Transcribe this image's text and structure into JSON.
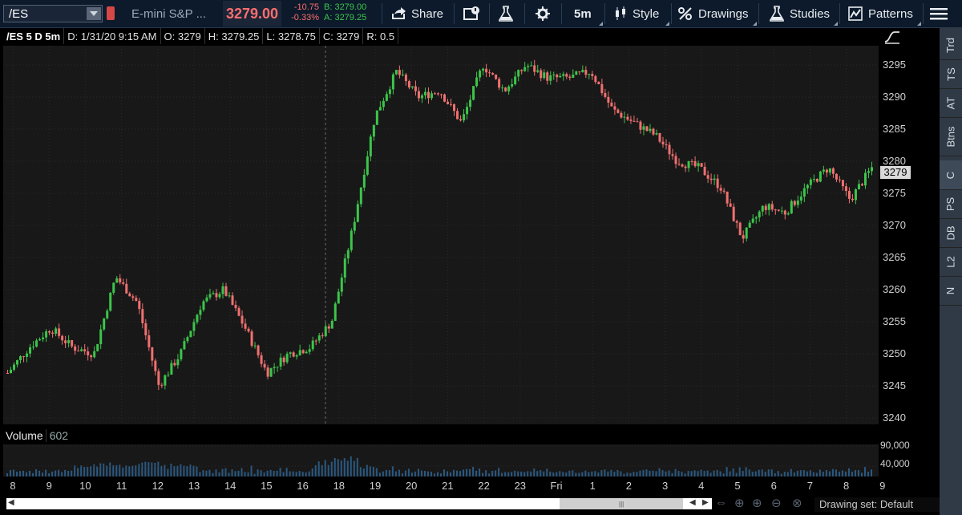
{
  "toolbar": {
    "symbol": "/ES",
    "description": "E-mini S&P ...",
    "last_price": "3279.00",
    "net_change": "-10.75",
    "pct_change": "-0.33%",
    "bid": "B: 3279.00",
    "ask": "A: 3279.25",
    "share": "Share",
    "aggregation": "5m",
    "style": "Style",
    "drawings": "Drawings",
    "studies": "Studies",
    "patterns": "Patterns"
  },
  "info_bar": {
    "symbol_period": "/ES 5 D 5m",
    "date": "D: 1/31/20 9:15 AM",
    "open": "O: 3279",
    "high": "H: 3279.25",
    "low": "L: 3278.75",
    "close": "C: 3279",
    "range": "R: 0.5"
  },
  "price_axis": {
    "labels": [
      "3295",
      "3290",
      "3285",
      "3280",
      "3275",
      "3270",
      "3265",
      "3260",
      "3255",
      "3250",
      "3245",
      "3240"
    ],
    "current_tag": "3279"
  },
  "volume": {
    "label": "Volume",
    "value": "602",
    "axis_labels": [
      "90,000",
      "40,000"
    ]
  },
  "time_axis": {
    "labels": [
      "8",
      "9",
      "10",
      "11",
      "12",
      "13",
      "14",
      "15",
      "16",
      "18",
      "19",
      "20",
      "21",
      "22",
      "23",
      "Fri",
      "1",
      "2",
      "3",
      "4",
      "5",
      "6",
      "7",
      "8",
      "9"
    ]
  },
  "right_panel": {
    "tabs": [
      "Trd",
      "TS",
      "AT",
      "Btns",
      "C",
      "PS",
      "DB",
      "L2",
      "N"
    ],
    "active": "C"
  },
  "bottom": {
    "drawing_set": "Drawing set: Default"
  },
  "colors": {
    "up": "#3cc54b",
    "down": "#f07070",
    "volume": "#3a8ed8",
    "background": "#181818",
    "toolbar": "#0c1a2b"
  },
  "chart_data": {
    "type": "candlestick",
    "interval": "5m",
    "ylim": [
      3239,
      3298
    ],
    "grid": true,
    "x": [
      "8",
      "9",
      "10",
      "11",
      "12",
      "13",
      "14",
      "15",
      "16",
      "18",
      "19",
      "20",
      "21",
      "22",
      "23",
      "Fri",
      "1",
      "2",
      "3",
      "4",
      "5",
      "6",
      "7",
      "8",
      "9"
    ],
    "series": [
      {
        "values": [
          3247,
          3251,
          3254,
          3251,
          3250,
          3262,
          3258,
          3245,
          3250,
          3258,
          3260,
          3254,
          3247,
          3250,
          3251,
          3255,
          3270,
          3287,
          3294,
          3290,
          3291,
          3286,
          3295,
          3291,
          3295,
          3293,
          3293,
          3294,
          3288,
          3286,
          3284,
          3280,
          3279,
          3276,
          3268,
          3273,
          3272,
          3276,
          3279,
          3274,
          3279
        ]
      }
    ]
  }
}
